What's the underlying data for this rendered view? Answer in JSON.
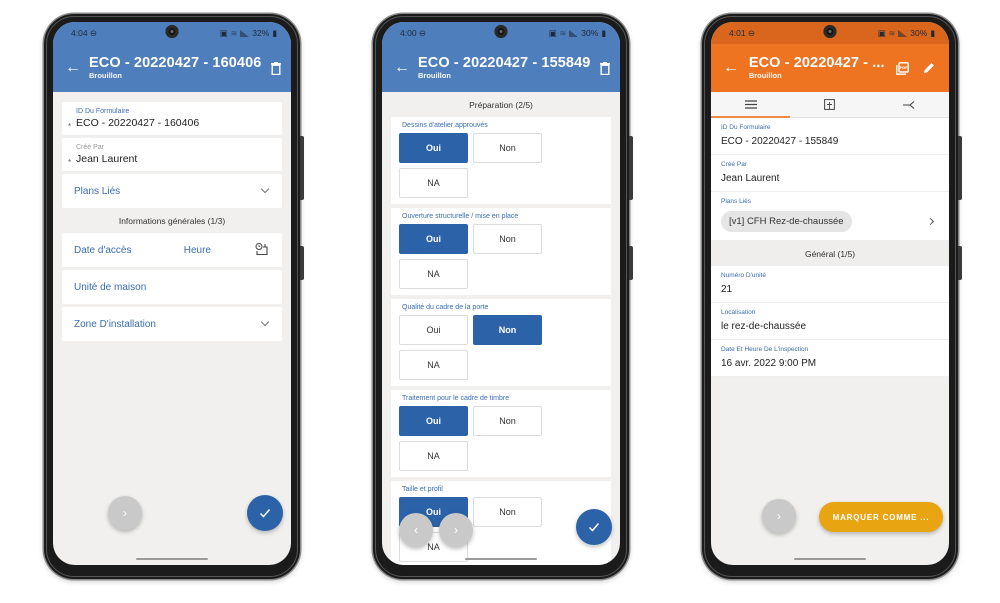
{
  "phones": [
    {
      "status": {
        "time": "4:04",
        "battery": "32%"
      },
      "appbar": {
        "title": "ECO - 20220427 - 160406",
        "subtitle": "Brouillon"
      },
      "fields": [
        {
          "label": "ID Du Formulaire",
          "value": "ECO - 20220427 - 160406",
          "required": "*"
        },
        {
          "label": "Créé Par",
          "value": "Jean Laurent",
          "required": "*"
        }
      ],
      "plans_lies": "Plans Liés",
      "section": "Informations générales (1/3)",
      "rows": {
        "date_acces": "Date d'accès",
        "heure": "Heure",
        "unite": "Unité de maison",
        "zone": "Zone D'installation"
      }
    },
    {
      "status": {
        "time": "4:00",
        "battery": "30%"
      },
      "appbar": {
        "title": "ECO - 20220427 - 155849",
        "subtitle": "Brouillon"
      },
      "section": "Préparation (2/5)",
      "options": {
        "yes": "Oui",
        "no": "Non",
        "na": "NA"
      },
      "questions": [
        {
          "label": "Dessins d'atelier approuvés",
          "selected": "Oui"
        },
        {
          "label": "Ouverture structurelle / mise en place",
          "selected": "Oui"
        },
        {
          "label": "Qualité du cadre de la porte",
          "selected": "Non"
        },
        {
          "label": "Traitement pour le cadre de timbre",
          "selected": "Oui"
        },
        {
          "label": "Taille et profil",
          "selected": "Oui"
        }
      ]
    },
    {
      "status": {
        "time": "4:01",
        "battery": "30%"
      },
      "appbar": {
        "title": "ECO - 20220427 - ...",
        "subtitle": "Brouillon"
      },
      "tabs": [
        "list-icon",
        "plan-icon",
        "branch-icon"
      ],
      "fields": [
        {
          "label": "ID Du Formulaire",
          "value": "ECO - 20220427 - 155849"
        },
        {
          "label": "Créé Par",
          "value": "Jean Laurent"
        }
      ],
      "plans": {
        "label": "Plans Liés",
        "chip": "[v1] CFH Rez-de-chaussée"
      },
      "section": "Général (1/5)",
      "general_fields": [
        {
          "label": "Numéro D'unité",
          "value": "21"
        },
        {
          "label": "Localisation",
          "value": "le rez-de-chaussée"
        },
        {
          "label": "Date Et Heure De L'inspection",
          "value": "16 avr. 2022 9:00 PM"
        }
      ],
      "mark_button": "MARQUER COMME ..."
    }
  ],
  "colors": {
    "blue_header": "#4e7fbc",
    "blue_selected": "#2b62a8",
    "orange_header": "#ee7421",
    "mark_button": "#e9a412"
  }
}
